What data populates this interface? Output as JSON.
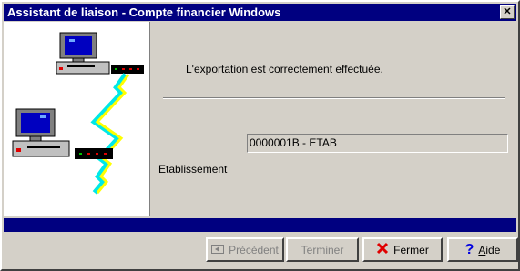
{
  "window": {
    "title": "Assistant de liaison - Compte financier Windows",
    "close_glyph": "✕"
  },
  "content": {
    "message": "L'exportation est correctement effectuée.",
    "etablissement_label": "Etablissement",
    "etablissement_value": "0000001B - ETAB"
  },
  "buttons": {
    "previous": "Précédent",
    "finish": "Terminer",
    "close": "Fermer",
    "help_underlined": "A",
    "help_rest": "ide"
  }
}
